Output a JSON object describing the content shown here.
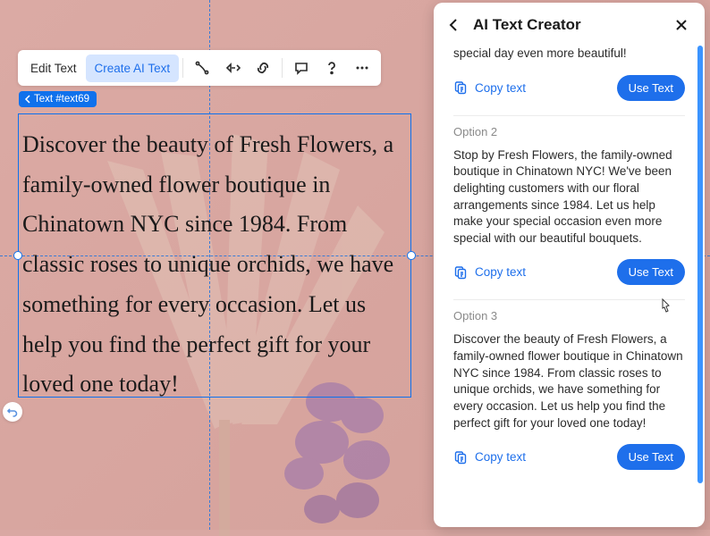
{
  "toolbar": {
    "edit_text": "Edit Text",
    "create_ai_text": "Create AI Text"
  },
  "element_tag": "Text #text69",
  "canvas_text": "Discover the beauty of Fresh Flowers, a family-owned flower boutique in Chinatown NYC since 1984. From classic roses to unique orchids, we have something for every occasion. Let us help you find the perfect gift for your loved one today!",
  "panel": {
    "title": "AI Text Creator",
    "copy_label": "Copy text",
    "use_label": "Use Text",
    "options": {
      "o1_partial": "special day even more beautiful!",
      "o2_label": "Option 2",
      "o2_text": "Stop by Fresh Flowers, the family-owned boutique in Chinatown NYC! We've been delighting customers with our floral arrangements since 1984. Let us help make your special occasion even more special with our beautiful bouquets.",
      "o3_label": "Option 3",
      "o3_text": "Discover the beauty of Fresh Flowers, a family-owned flower boutique in Chinatown NYC since 1984. From classic roses to unique orchids, we have something for every occasion. Let us help you find the perfect gift for your loved one today!"
    }
  }
}
